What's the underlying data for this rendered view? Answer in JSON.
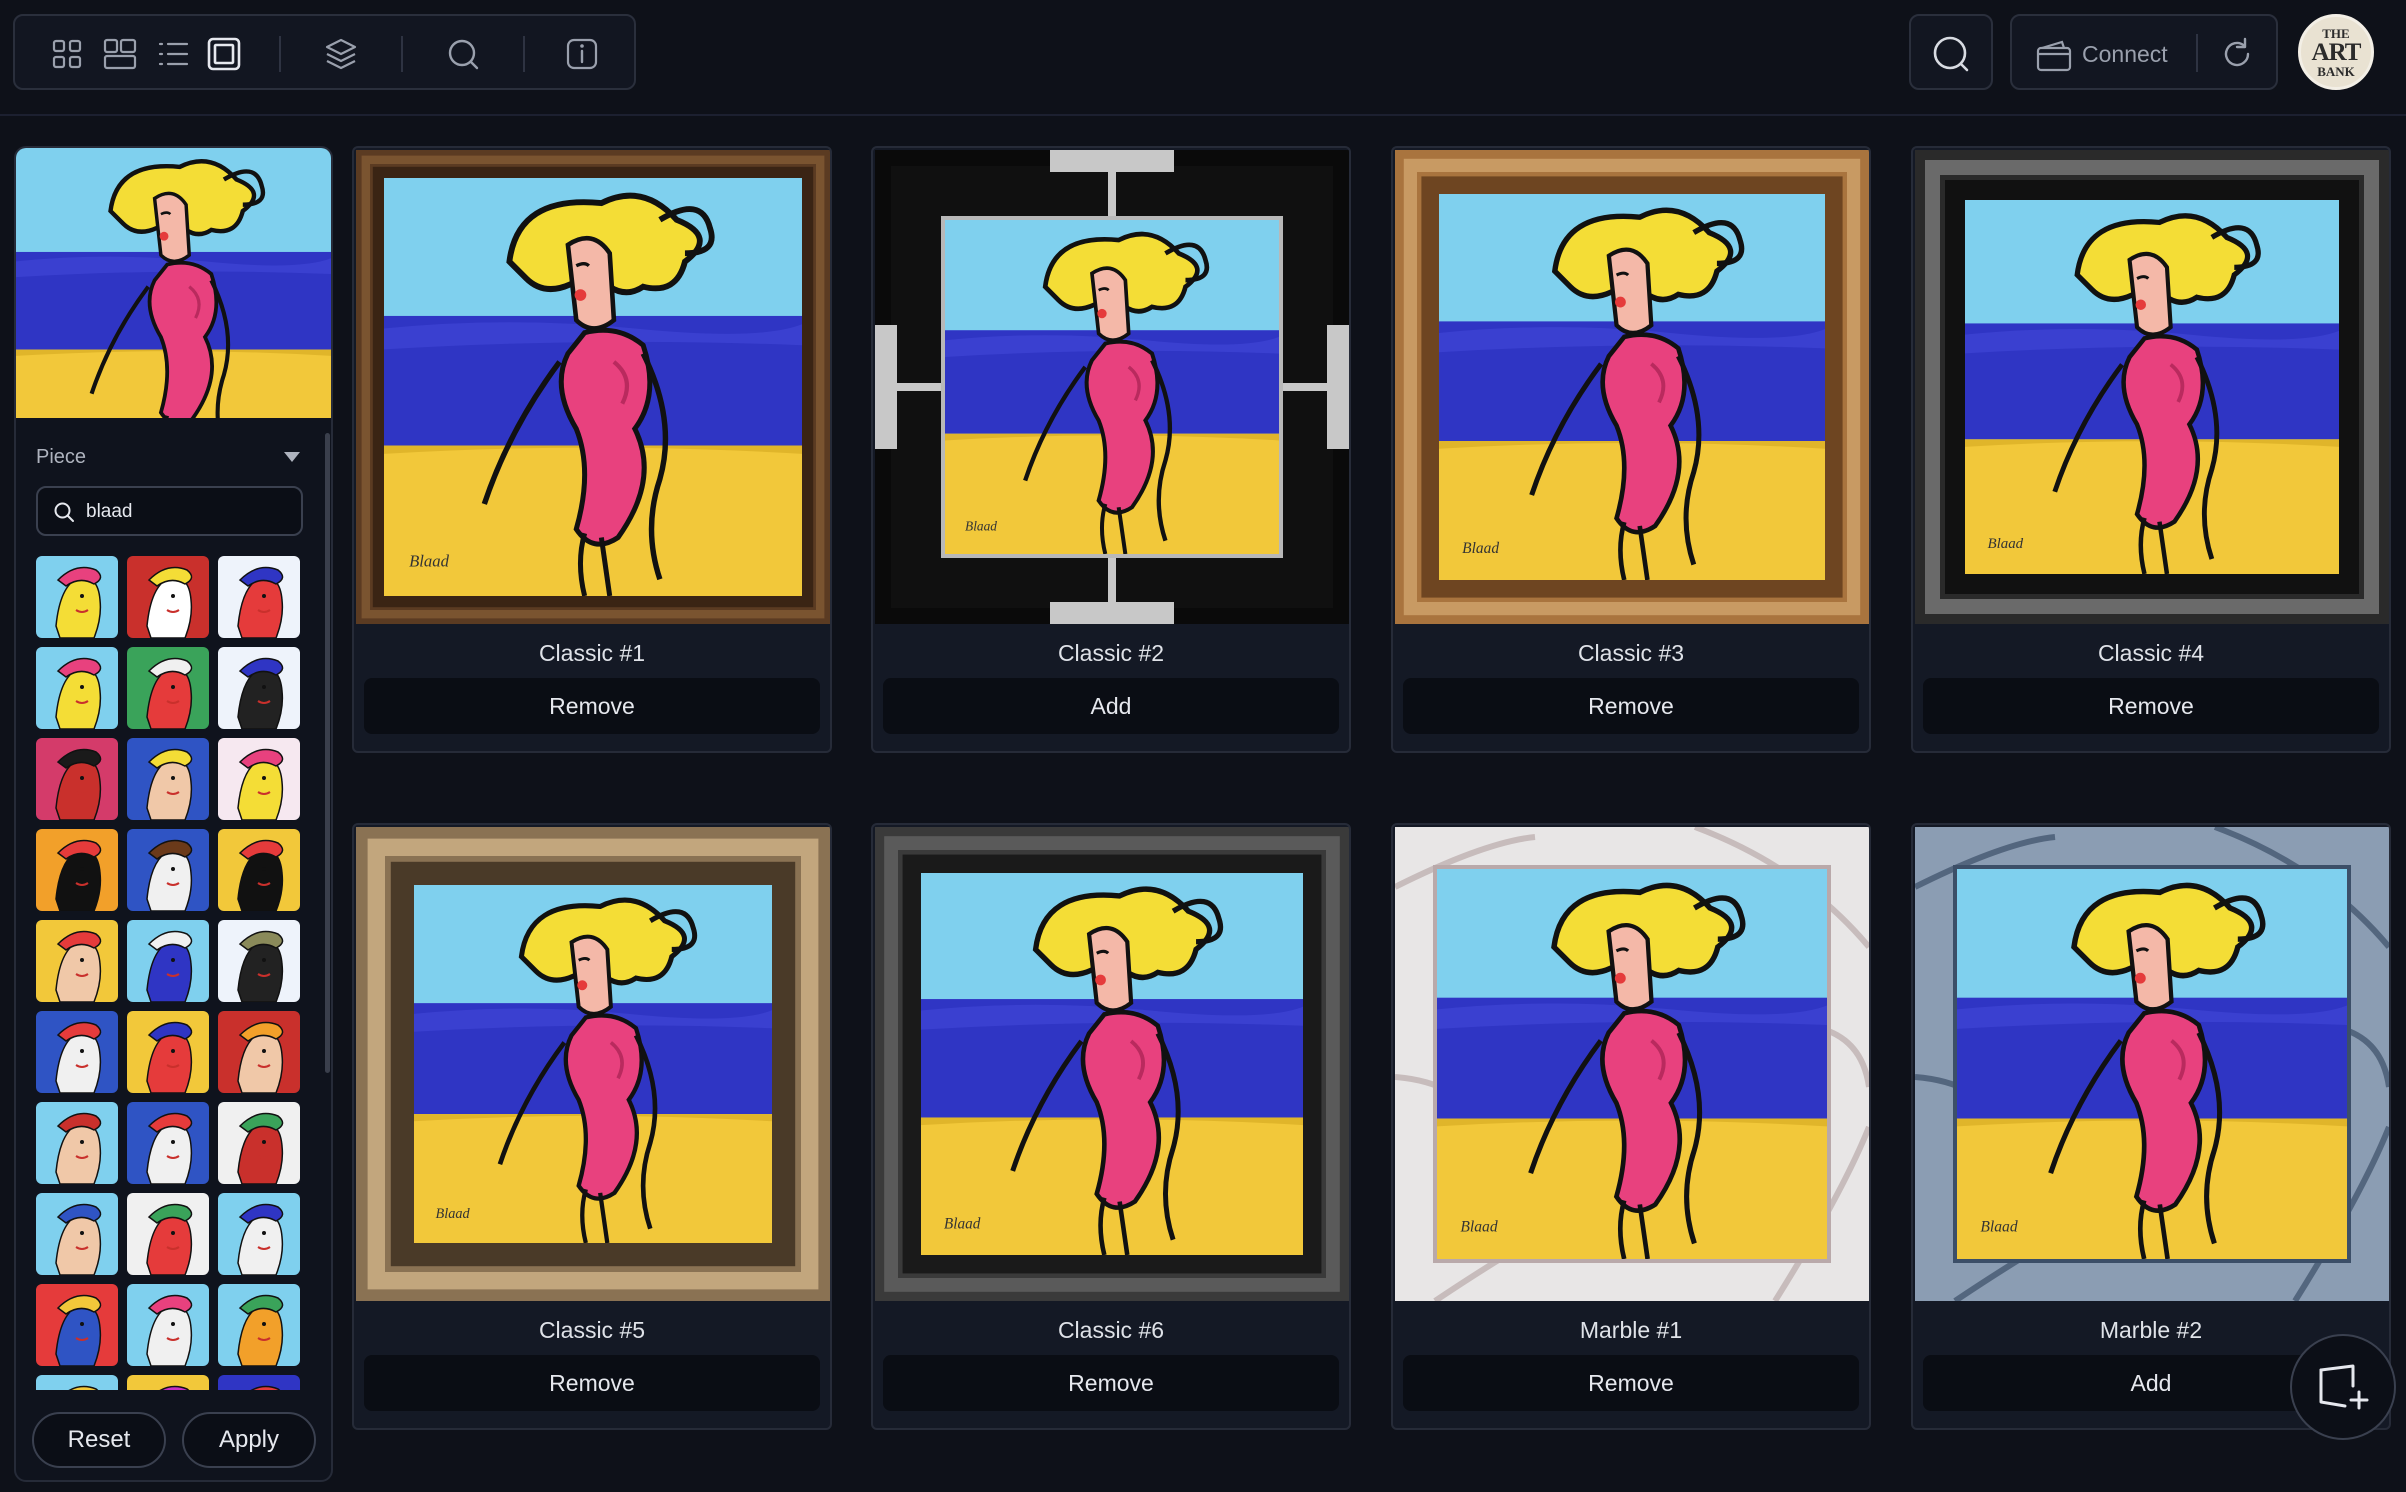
{
  "toolbar": {
    "icons": [
      "grid-small-icon",
      "grid-large-icon",
      "list-icon",
      "single-view-icon",
      "layers-icon",
      "search-icon",
      "info-icon"
    ],
    "connect_label": "Connect",
    "logo_lines": [
      "THE",
      "ART",
      "BANK"
    ]
  },
  "sidebar": {
    "section_label": "Piece",
    "search_value": "blaad",
    "reset_label": "Reset",
    "apply_label": "Apply",
    "thumbnails": 30
  },
  "cards": [
    {
      "name": "Classic #1",
      "action": "Remove",
      "frame": "classic-1"
    },
    {
      "name": "Classic #2",
      "action": "Add",
      "frame": "classic-2"
    },
    {
      "name": "Classic #3",
      "action": "Remove",
      "frame": "classic-3"
    },
    {
      "name": "Classic #4",
      "action": "Remove",
      "frame": "classic-4"
    },
    {
      "name": "Classic #5",
      "action": "Remove",
      "frame": "classic-5"
    },
    {
      "name": "Classic #6",
      "action": "Remove",
      "frame": "classic-6"
    },
    {
      "name": "Marble #1",
      "action": "Remove",
      "frame": "marble-1"
    },
    {
      "name": "Marble #2",
      "action": "Add",
      "frame": "marble-2"
    }
  ],
  "colors": {
    "background": "#0e1119",
    "card": "#141925",
    "sky": "#7fd0ee",
    "sea": "#2e33c6",
    "sand": "#f2c83a",
    "dress": "#e8417e",
    "hat": "#f4dd36"
  },
  "artwork_signature": "Blaad"
}
